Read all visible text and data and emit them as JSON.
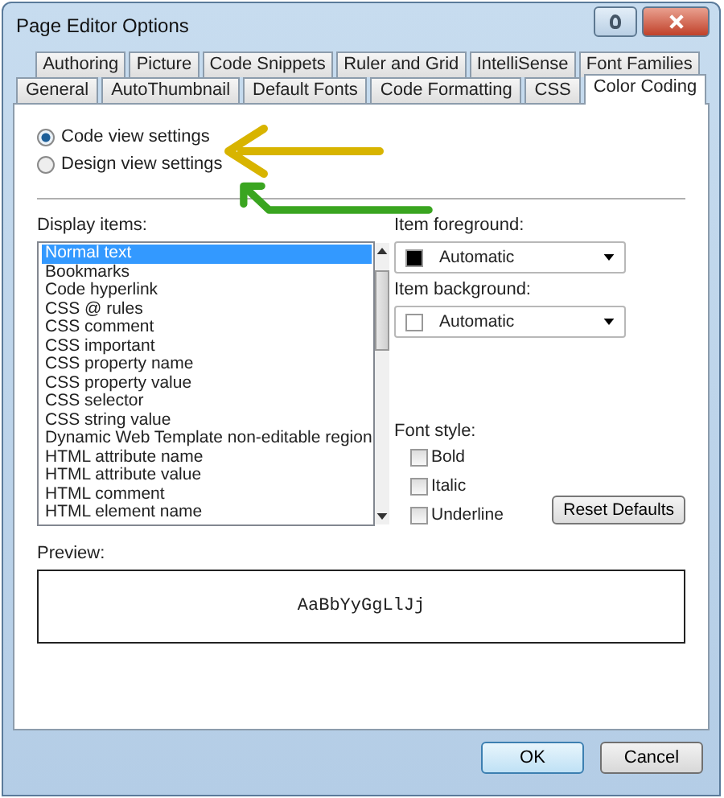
{
  "window": {
    "title": "Page Editor Options"
  },
  "tab_rows": [
    [
      {
        "label": "Authoring",
        "selected": false
      },
      {
        "label": "Picture",
        "selected": false
      },
      {
        "label": "Code Snippets",
        "selected": false
      },
      {
        "label": "Ruler and Grid",
        "selected": false
      },
      {
        "label": "IntelliSense",
        "selected": false
      },
      {
        "label": "Font Families",
        "selected": false
      }
    ],
    [
      {
        "label": "General",
        "selected": false
      },
      {
        "label": "AutoThumbnail",
        "selected": false
      },
      {
        "label": "Default Fonts",
        "selected": false
      },
      {
        "label": "Code Formatting",
        "selected": false
      },
      {
        "label": "CSS",
        "selected": false
      },
      {
        "label": "Color Coding",
        "selected": true
      }
    ]
  ],
  "view_options": [
    {
      "label": "Code view settings",
      "selected": true
    },
    {
      "label": "Design view settings",
      "selected": false
    }
  ],
  "display_items": {
    "label": "Display items:",
    "items": [
      {
        "label": "Normal text",
        "selected": true
      },
      {
        "label": "Bookmarks",
        "selected": false
      },
      {
        "label": "Code hyperlink",
        "selected": false
      },
      {
        "label": "CSS @ rules",
        "selected": false
      },
      {
        "label": "CSS comment",
        "selected": false
      },
      {
        "label": "CSS important",
        "selected": false
      },
      {
        "label": "CSS property name",
        "selected": false
      },
      {
        "label": "CSS property value",
        "selected": false
      },
      {
        "label": "CSS selector",
        "selected": false
      },
      {
        "label": "CSS string value",
        "selected": false
      },
      {
        "label": "Dynamic Web Template non-editable region",
        "selected": false
      },
      {
        "label": "HTML attribute name",
        "selected": false
      },
      {
        "label": "HTML attribute value",
        "selected": false
      },
      {
        "label": "HTML comment",
        "selected": false
      },
      {
        "label": "HTML element name",
        "selected": false
      }
    ]
  },
  "item_foreground": {
    "label": "Item foreground:",
    "value": "Automatic",
    "color": "#000000"
  },
  "item_background": {
    "label": "Item background:",
    "value": "Automatic",
    "color": "#ffffff"
  },
  "font_style": {
    "label": "Font style:",
    "options": [
      {
        "label": "Bold",
        "checked": false
      },
      {
        "label": "Italic",
        "checked": false
      },
      {
        "label": "Underline",
        "checked": false
      }
    ]
  },
  "reset_button": "Reset Defaults",
  "preview": {
    "label": "Preview:",
    "sample": "AaBbYyGgLlJj"
  },
  "buttons": [
    "OK",
    "Cancel"
  ]
}
